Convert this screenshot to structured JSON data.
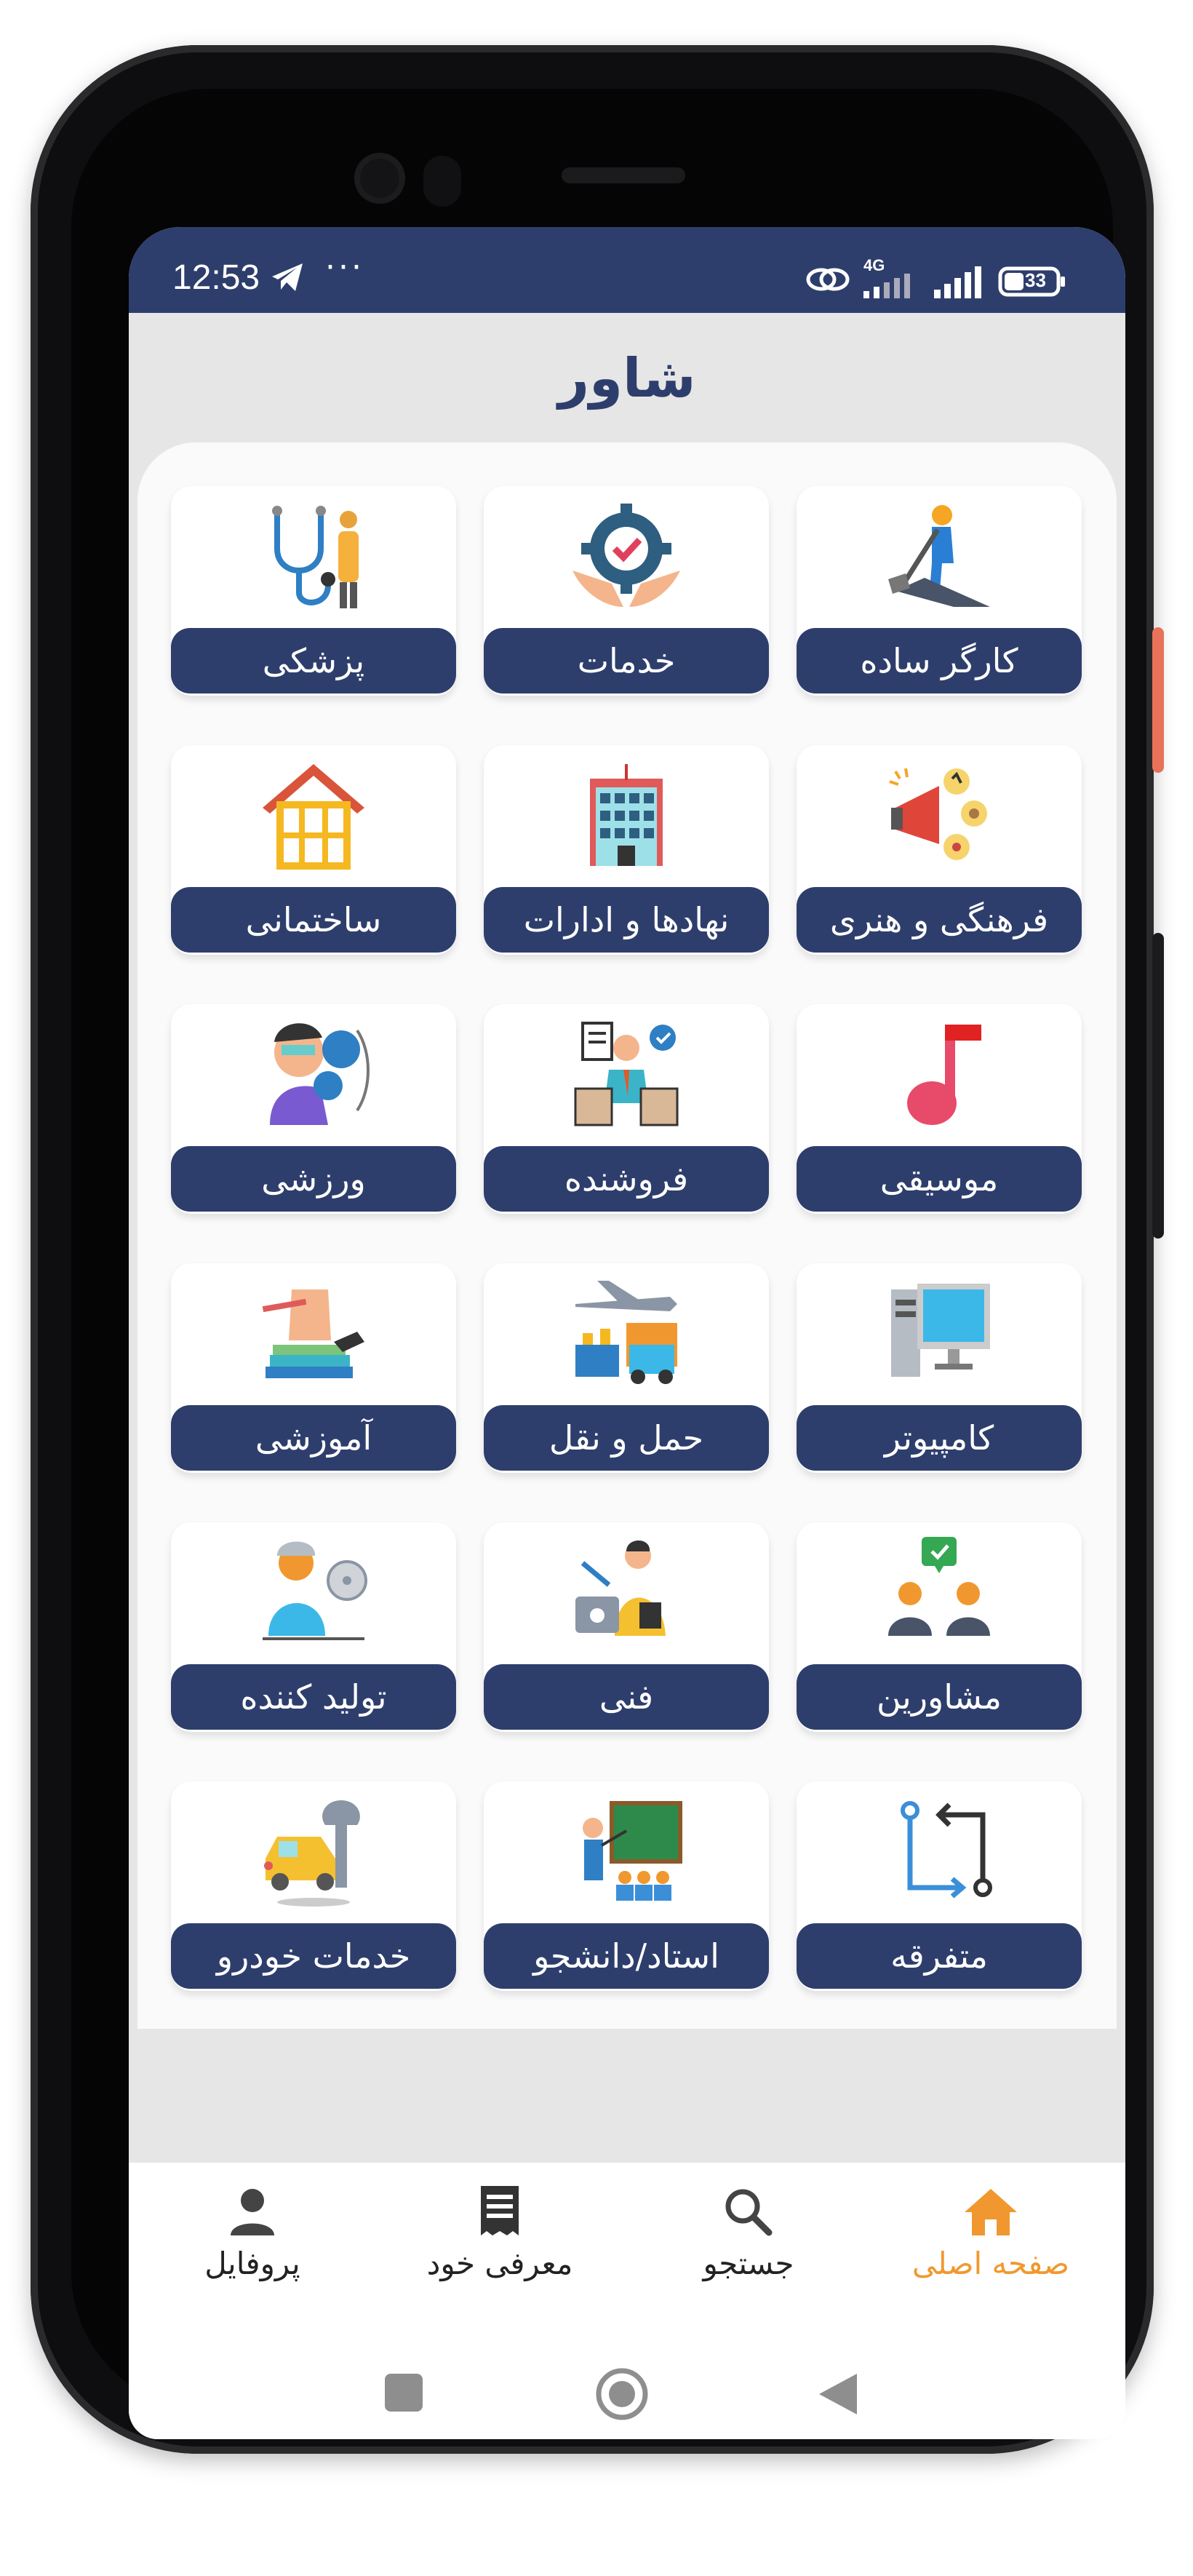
{
  "status": {
    "time": "12:53",
    "network": "4G",
    "battery": "33"
  },
  "app": {
    "title": "شاور"
  },
  "categories": [
    {
      "label": "کارگر ساده",
      "icon": "worker-shovel-icon"
    },
    {
      "label": "خدمات",
      "icon": "gear-hands-check-icon"
    },
    {
      "label": "پزشکی",
      "icon": "doctor-stethoscope-icon"
    },
    {
      "label": "فرهنگی و هنری",
      "icon": "megaphone-arts-icon"
    },
    {
      "label": "نهادها و ادارات",
      "icon": "office-building-icon"
    },
    {
      "label": "ساختمانی",
      "icon": "house-icon"
    },
    {
      "label": "موسیقی",
      "icon": "music-note-icon"
    },
    {
      "label": "فروشنده",
      "icon": "salesperson-icon"
    },
    {
      "label": "ورزشی",
      "icon": "boxer-icon"
    },
    {
      "label": "کامپیوتر",
      "icon": "desktop-computer-icon"
    },
    {
      "label": "حمل و نقل",
      "icon": "transport-plane-truck-icon"
    },
    {
      "label": "آموزشی",
      "icon": "education-books-icon"
    },
    {
      "label": "مشاورین",
      "icon": "consultants-icon"
    },
    {
      "label": "فنی",
      "icon": "technician-toolbox-icon"
    },
    {
      "label": "تولید کننده",
      "icon": "producer-film-icon"
    },
    {
      "label": "متفرقه",
      "icon": "misc-arrows-icon"
    },
    {
      "label": "استاد/دانشجو",
      "icon": "teacher-board-icon"
    },
    {
      "label": "خدمات خودرو",
      "icon": "car-wrench-icon"
    }
  ],
  "bottom_nav": [
    {
      "label": "صفحه اصلی",
      "icon": "home-icon",
      "active": true
    },
    {
      "label": "جستجو",
      "icon": "search-icon",
      "active": false
    },
    {
      "label": "معرفی خود",
      "icon": "document-icon",
      "active": false
    },
    {
      "label": "پروفایل",
      "icon": "person-icon",
      "active": false
    }
  ],
  "colors": {
    "primary": "#2e3e6c",
    "accent": "#f0982f",
    "background": "#e6e6e6"
  }
}
